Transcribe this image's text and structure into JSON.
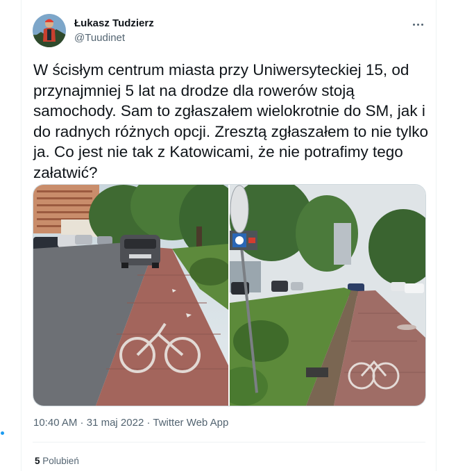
{
  "author": {
    "display_name": "Łukasz Tudzierz",
    "handle": "@Tuudinet",
    "avatar_icon": "avatar-photo"
  },
  "more_icon": "more-horizontal-icon",
  "tweet": {
    "text": "W ścisłym centrum miasta przy Uniwersyteckiej 15, od przynajmniej 5 lat na drodze dla rowerów stoją samochody. Sam to zgłaszałem wielokrotnie do SM, jak i do radnych różnych opcji. Zresztą zgłaszałem to nie tylko ja. Co jest nie tak z Katowicami, że nie potrafimy tego załatwić?"
  },
  "media": {
    "photos": [
      {
        "name": "photo-left"
      },
      {
        "name": "photo-right"
      }
    ]
  },
  "meta": {
    "time": "10:40 AM",
    "separator1": " · ",
    "date": "31 maj 2022",
    "separator2": " · ",
    "source": "Twitter Web App"
  },
  "stats": {
    "likes_count": "5",
    "likes_label": "Polubień"
  },
  "colors": {
    "accent": "#1d9bf0",
    "text_primary": "#0f1419",
    "text_secondary": "#536471",
    "border": "#cfd9de"
  }
}
